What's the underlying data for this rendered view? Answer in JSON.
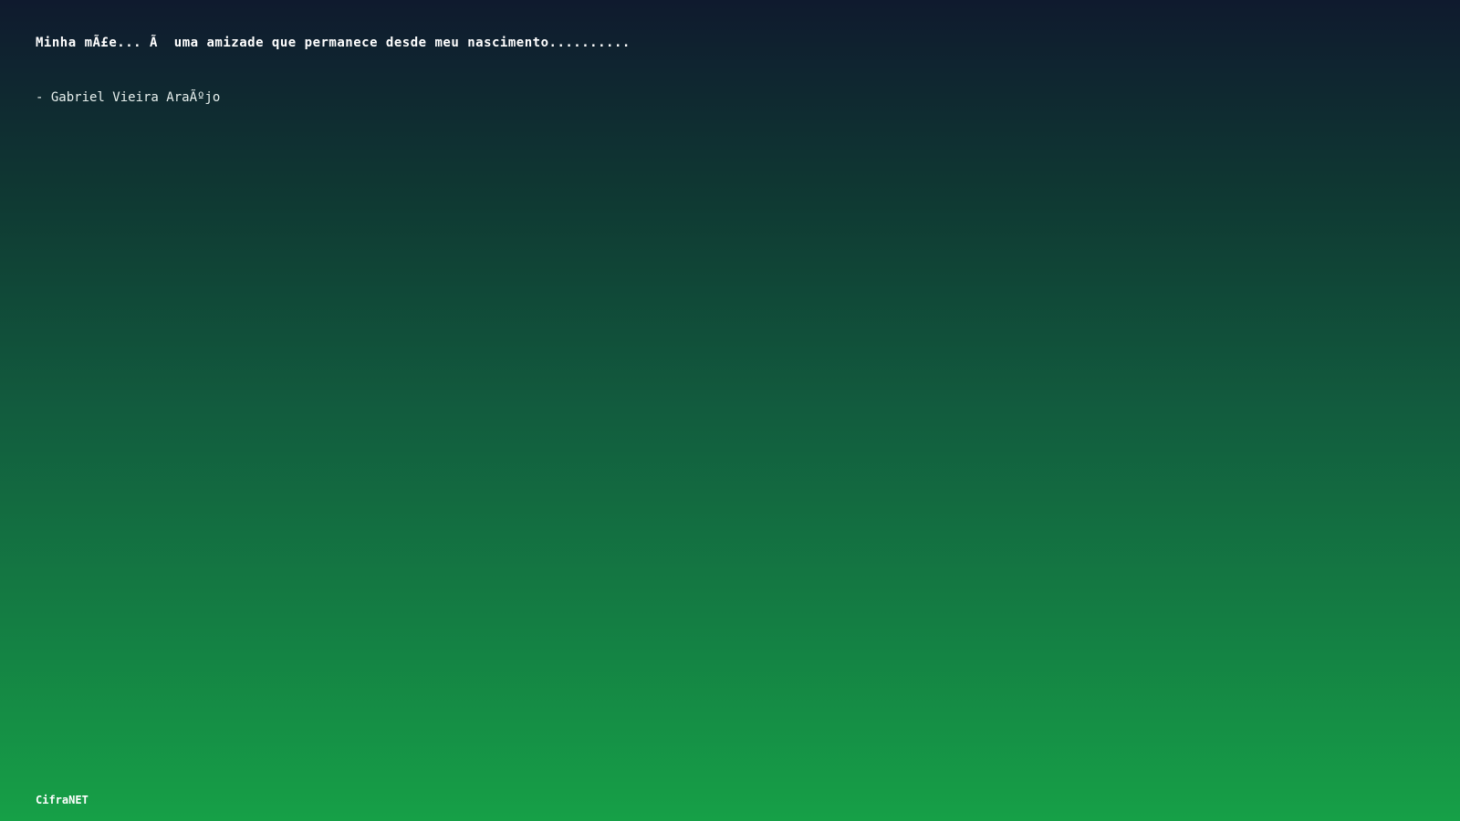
{
  "quote": {
    "text": "Minha mÃ£e... Ã  uma amizade que permanece desde meu nascimento..........",
    "author": "- Gabriel Vieira AraÃºjo"
  },
  "footer": {
    "brand": "CifraNET"
  },
  "colors": {
    "gradient_top": "#0f1a2e",
    "gradient_bottom": "#16a047",
    "text": "#ffffff"
  }
}
